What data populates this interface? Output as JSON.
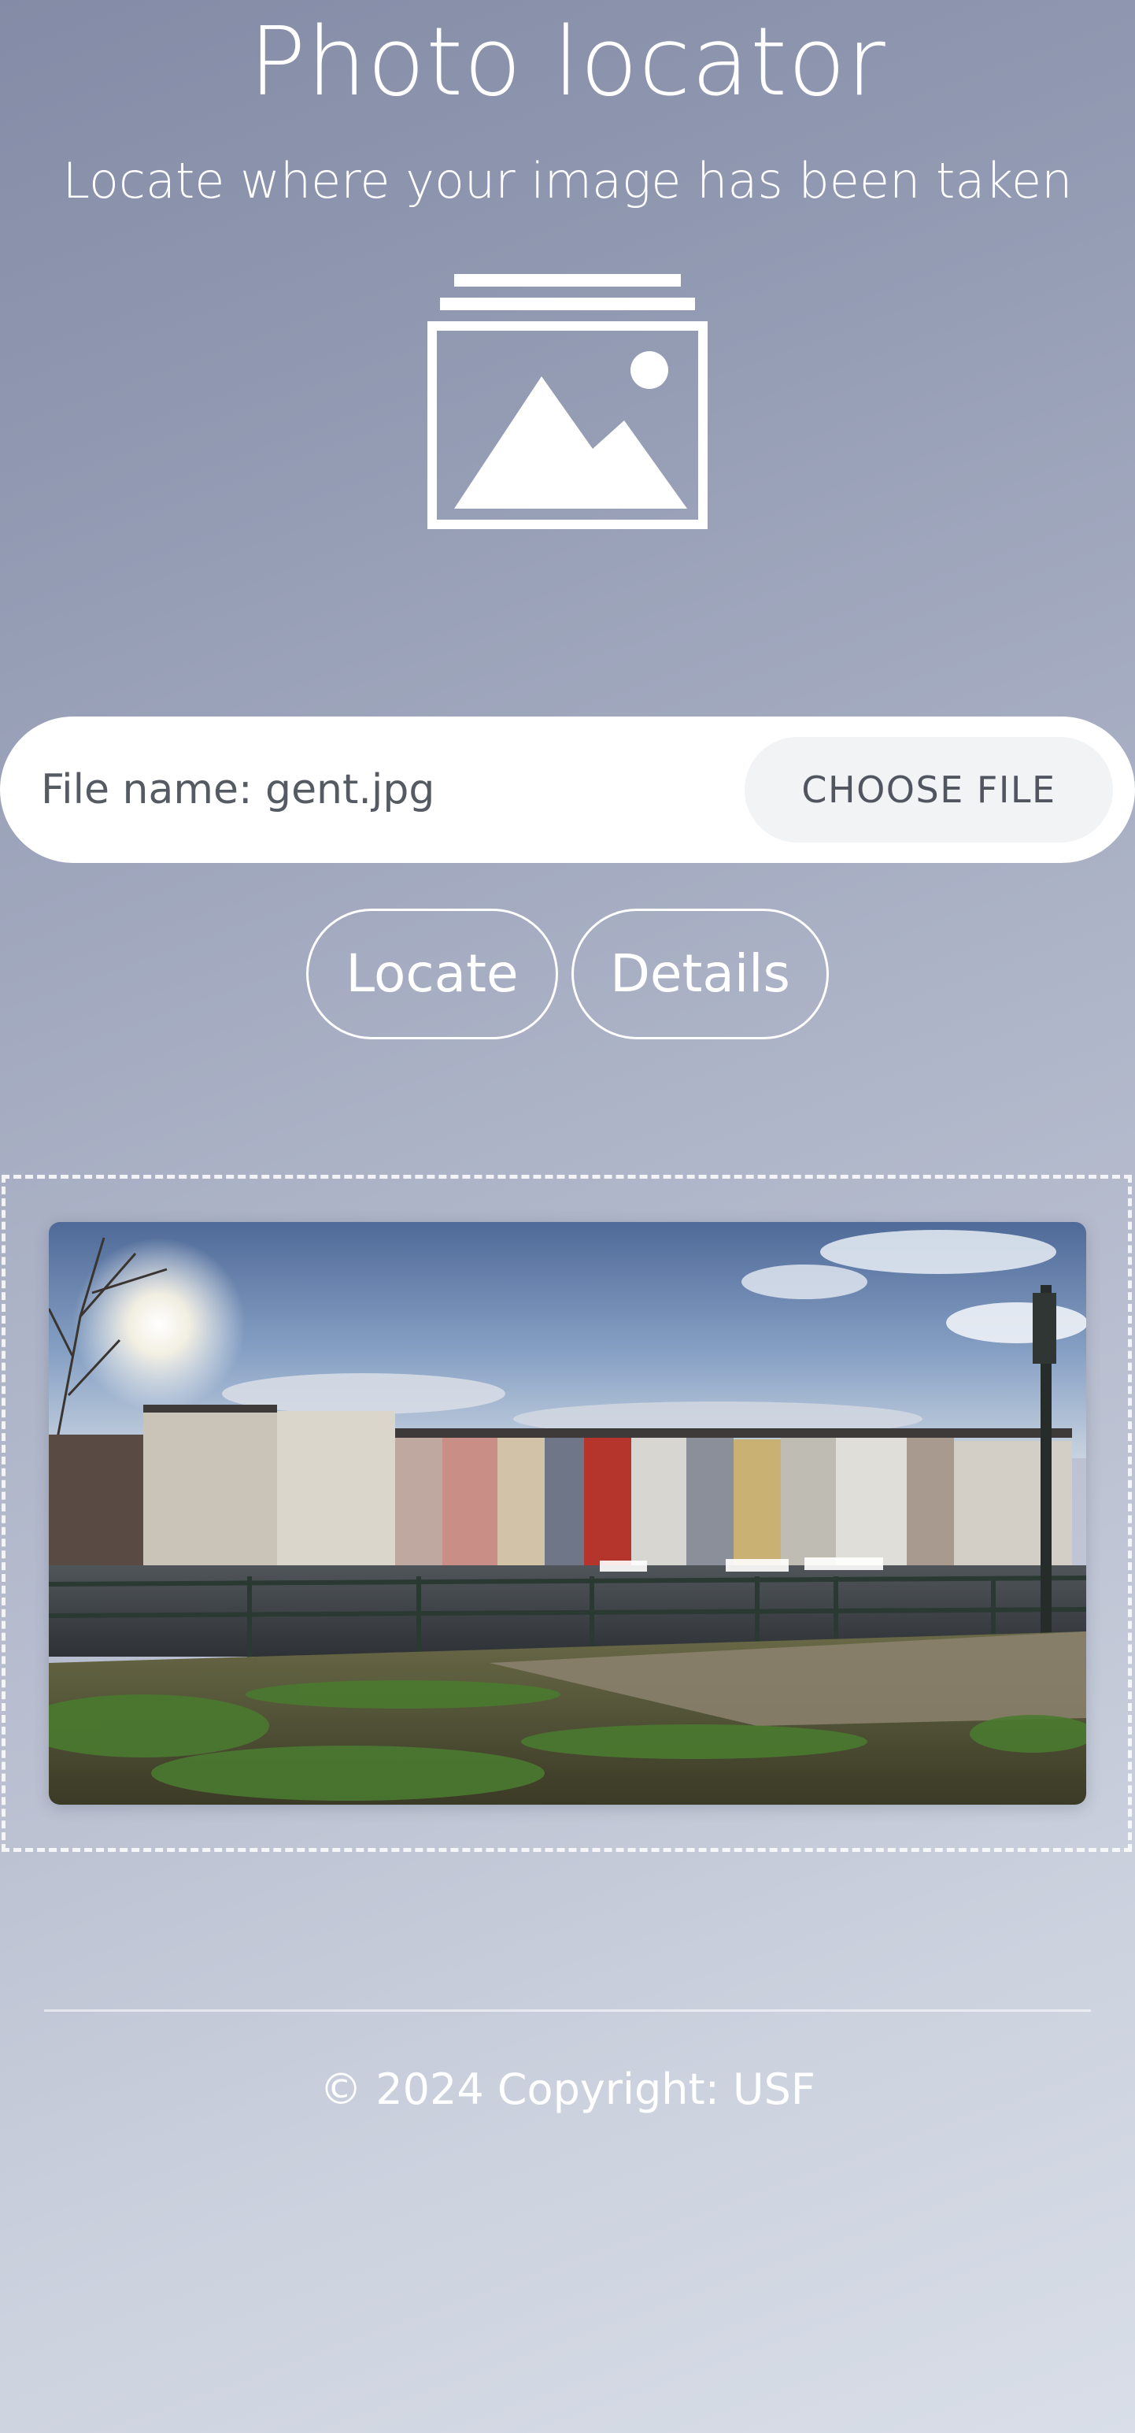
{
  "header": {
    "title": "Photo locator",
    "subtitle": "Locate where your image has been taken",
    "icon": "photo-gallery-icon"
  },
  "upload": {
    "file_name_label": "File name: gent.jpg",
    "choose_file_label": "CHOOSE FILE"
  },
  "actions": {
    "locate_label": "Locate",
    "details_label": "Details"
  },
  "preview": {
    "image_alt": "gent.jpg"
  },
  "footer": {
    "copyright": "© 2024 Copyright: USF"
  },
  "colors": {
    "background_top": "#838ba6",
    "background_bottom": "#d9dee8",
    "text": "#ffffff",
    "file_bar": "#ffffff",
    "choose_button": "#f2f3f5"
  }
}
